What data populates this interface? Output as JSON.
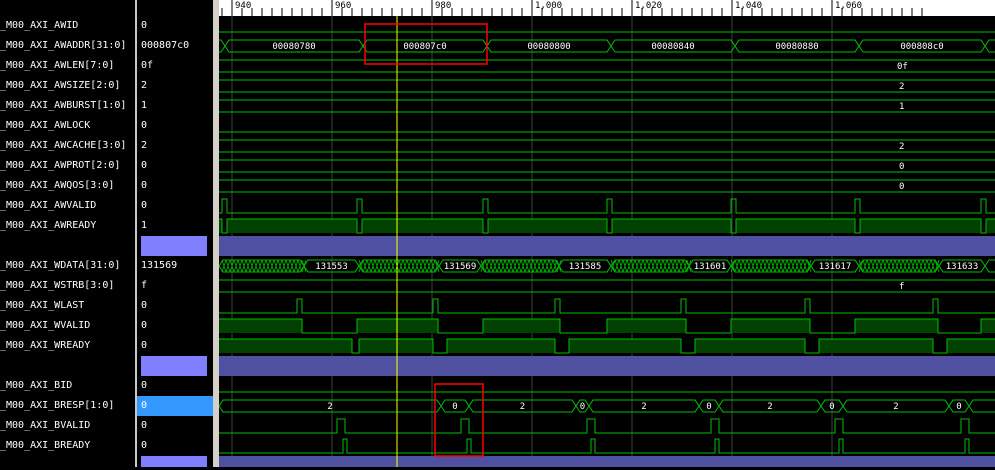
{
  "signals": [
    {
      "name": "_M00_AXI_AWID",
      "value": "0"
    },
    {
      "name": "_M00_AXI_AWADDR[31:0]",
      "value": "000807c0"
    },
    {
      "name": "_M00_AXI_AWLEN[7:0]",
      "value": "0f"
    },
    {
      "name": "_M00_AXI_AWSIZE[2:0]",
      "value": "2"
    },
    {
      "name": "_M00_AXI_AWBURST[1:0]",
      "value": "1"
    },
    {
      "name": "_M00_AXI_AWLOCK",
      "value": "0"
    },
    {
      "name": "_M00_AXI_AWCACHE[3:0]",
      "value": "2"
    },
    {
      "name": "_M00_AXI_AWPROT[2:0]",
      "value": "0"
    },
    {
      "name": "_M00_AXI_AWQOS[3:0]",
      "value": "0"
    },
    {
      "name": "_M00_AXI_AWVALID",
      "value": "0"
    },
    {
      "name": "_M00_AXI_AWREADY",
      "value": "1"
    },
    {
      "name": "",
      "value": ""
    },
    {
      "name": "_M00_AXI_WDATA[31:0]",
      "value": "131569"
    },
    {
      "name": "_M00_AXI_WSTRB[3:0]",
      "value": "f"
    },
    {
      "name": "_M00_AXI_WLAST",
      "value": "0"
    },
    {
      "name": "_M00_AXI_WVALID",
      "value": "0"
    },
    {
      "name": "_M00_AXI_WREADY",
      "value": "0"
    },
    {
      "name": "",
      "value": ""
    },
    {
      "name": "_M00_AXI_BID",
      "value": "0"
    },
    {
      "name": "_M00_AXI_BRESP[1:0]",
      "value": "0"
    },
    {
      "name": "_M00_AXI_BVALID",
      "value": "0"
    },
    {
      "name": "_M00_AXI_BREADY",
      "value": "0"
    }
  ],
  "timeline": {
    "ticks": [
      "940",
      "960",
      "980",
      "1,000",
      "1,020",
      "1,040",
      "1,060"
    ],
    "cursor_time": 973
  },
  "bus_labels": {
    "awaddr": [
      "00080780",
      "000807c0",
      "00080800",
      "00080840",
      "00080880",
      "000808c0"
    ],
    "awlen": "0f",
    "awsize": "2",
    "awburst": "1",
    "awcache": "2",
    "awprot": "0",
    "awqos": "0",
    "wdata": [
      "131553",
      "131569",
      "131585",
      "131601",
      "131617",
      "131633"
    ],
    "wstrb": "f",
    "bresp": [
      "2",
      "0",
      "2",
      "0",
      "2",
      "0",
      "2",
      "0",
      "2",
      "0"
    ]
  },
  "colors": {
    "wave": "#00c000",
    "fill": "#004000",
    "cursor": "#ffff00",
    "highlight": "#ff0000",
    "divider": "#5050a0",
    "grid": "#404040"
  }
}
